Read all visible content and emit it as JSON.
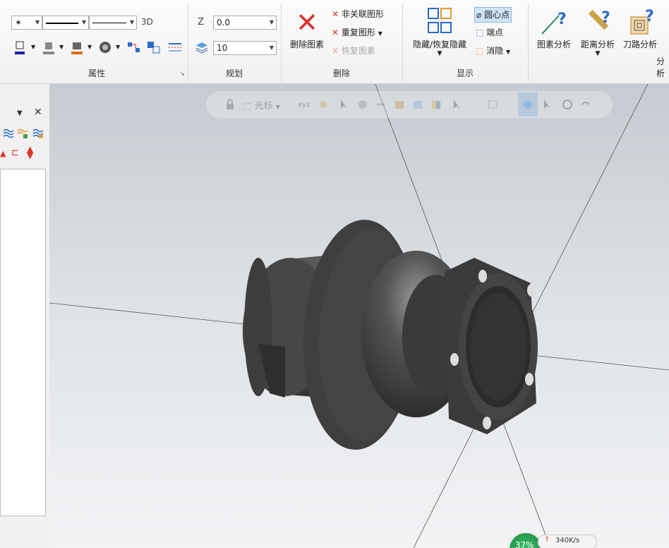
{
  "ribbon": {
    "attributes": {
      "point_style_symbol": "✶",
      "mode_3d_label": "3D",
      "group_label": "属性"
    },
    "planning": {
      "z_label": "Z",
      "z_value": "0.0",
      "level_value": "10",
      "group_label": "规划"
    },
    "delete": {
      "delete_entity_label": "删除图素",
      "nonassoc_label": "非关联图形",
      "duplicate_label": "重复图形",
      "restore_label": "恢复图素",
      "group_label": "删除"
    },
    "display": {
      "hide_restore_label": "隐藏/恢复隐藏",
      "center_point_label": "圆心点",
      "endpoint_label": "端点",
      "eliminate_label": "消隐",
      "group_label": "显示"
    },
    "analysis": {
      "entity_analysis_label": "图素分析",
      "distance_analysis_label": "距离分析",
      "toolpath_analysis_label": "刀路分析",
      "group_label_partial": "分析"
    }
  },
  "viewport": {
    "float_toolbar": {
      "cursor_label": "光标",
      "xyz_label": "xyz"
    },
    "status": {
      "percent": "37%",
      "speed": "340K/s"
    }
  },
  "colors": {
    "delete_red": "#d9342b",
    "model_gray": "#4a4a4a",
    "highlight_blue": "#cfe3f7"
  }
}
